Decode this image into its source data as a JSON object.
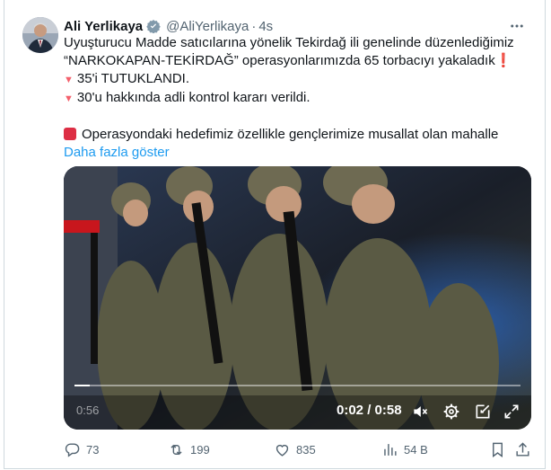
{
  "tweet": {
    "author_name": "Ali Yerlikaya",
    "handle": "@AliYerlikaya",
    "separator": "·",
    "time": "4s",
    "lines": {
      "l1": "Uyuşturucu Madde satıcılarına yönelik Tekirdağ ili genelinde düzenlediğimiz",
      "l2": "“NARKOKAPAN-TEKİRDAĞ” operasyonlarımızda 65 torbacıyı yakaladık",
      "l2_emoji": "❗",
      "l3": "35'i TUTUKLANDI.",
      "l4": "30'u hakkında adli kontrol kararı verildi.",
      "l5": "Operasyondaki hedefimiz özellikle gençlerimize musallat olan mahalle"
    },
    "show_more": "Daha fazla göster"
  },
  "video": {
    "current_time": "0:02",
    "duration_sep": " / ",
    "duration": "0:58",
    "faint_time": "0:56",
    "progress_fraction": 0.034
  },
  "actions": {
    "replies": "73",
    "reposts": "199",
    "likes": "835",
    "views": "54 B"
  },
  "colors": {
    "accent": "#1d9bf0",
    "verified": "#829aab",
    "text_secondary": "#536471"
  }
}
